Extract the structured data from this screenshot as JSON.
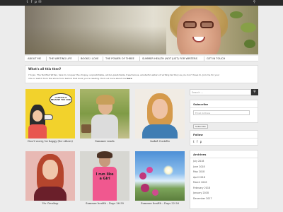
{
  "topbar": {
    "icons": [
      "twitter-icon",
      "facebook-icon",
      "pinterest-icon",
      "email-icon",
      "search-icon"
    ]
  },
  "nav": {
    "items": [
      "ABOUT ME",
      "THE WRITING LIFE",
      "BOOKS I LOVE",
      "THE POWER OF THREE",
      "SUMMER HEALTH (NOT JUST) FOR WRITERS",
      "GET IN TOUCH"
    ]
  },
  "intro": {
    "title": "What's all this then?",
    "body": "I'm Jen. The Terrified Writer, here to conquer the choppy, unpredictable, all-too-predictable, treacherous, wonderful waters of writing territory as you don't have to. Join me for your",
    "body2": "ride or watch from the shore from behind that book you're reading.  Find out more about me",
    "link": "here"
  },
  "posts": [
    {
      "caption": "Don't worry, be happy (for others)"
    },
    {
      "caption": "Summer reads"
    },
    {
      "caption": "Isabel Costello"
    },
    {
      "caption": "Viv Groskop"
    },
    {
      "caption": "Summer health – Days 26-30"
    },
    {
      "caption": "Summer health – Days 22-26"
    }
  ],
  "post_image_text": [
    "I CAN DO IT BECAUSE YOU CAN!",
    "I run like a Girl"
  ],
  "sidebar": {
    "search_placeholder": "Search ...",
    "subscribe_title": "Subscribe",
    "email_placeholder": "Email Address",
    "subscribe_button": "Subscribe",
    "follow_title": "Follow",
    "follow_icons": [
      "twitter-icon",
      "facebook-icon",
      "pinterest-icon"
    ],
    "archives_title": "Archives",
    "archives": [
      "July 2018",
      "June 2018",
      "May 2018",
      "April 2018",
      "March 2018",
      "February 2018",
      "January 2018",
      "December 2017"
    ]
  },
  "colors": {
    "topbar": "#2b2b2b",
    "background": "#ececec",
    "panel": "#ffffff"
  }
}
